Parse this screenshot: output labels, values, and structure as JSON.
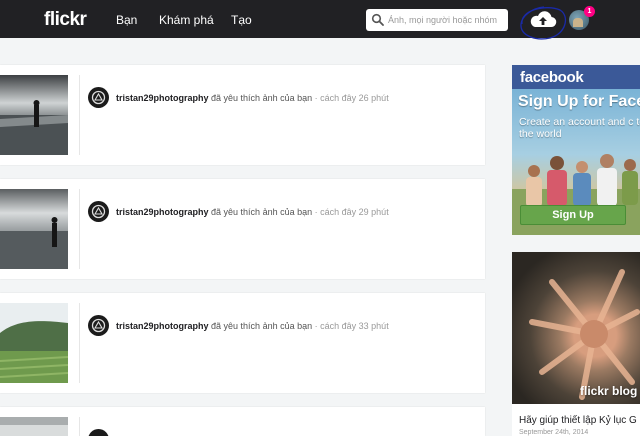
{
  "header": {
    "logo": "flickr",
    "nav": [
      "Bạn",
      "Khám phá",
      "Tạo"
    ],
    "search_placeholder": "Ảnh, mọi người hoặc nhóm",
    "notification_count": "1"
  },
  "feed": [
    {
      "username": "tristan29photography",
      "action": "đã yêu thích ảnh của bạn",
      "time": "· cách đây 26 phút"
    },
    {
      "username": "tristan29photography",
      "action": "đã yêu thích ảnh của bạn",
      "time": "· cách đây 29 phút"
    },
    {
      "username": "tristan29photography",
      "action": "đã yêu thích ảnh của bạn",
      "time": "· cách đây 33 phút"
    }
  ],
  "ads": {
    "facebook": {
      "logo": "facebook",
      "headline": "Sign Up for Face",
      "subline": "Create an account and c to the world",
      "button": "Sign Up"
    },
    "blog": {
      "brand": "flickr blog",
      "title": "Hãy giúp thiết lập Kỷ lục G",
      "date": "September 24th, 2014"
    }
  },
  "colors": {
    "topbar": "#212124",
    "accent_pink": "#ff0084",
    "facebook_blue": "#3b5998",
    "signup_green": "#67a54b"
  }
}
